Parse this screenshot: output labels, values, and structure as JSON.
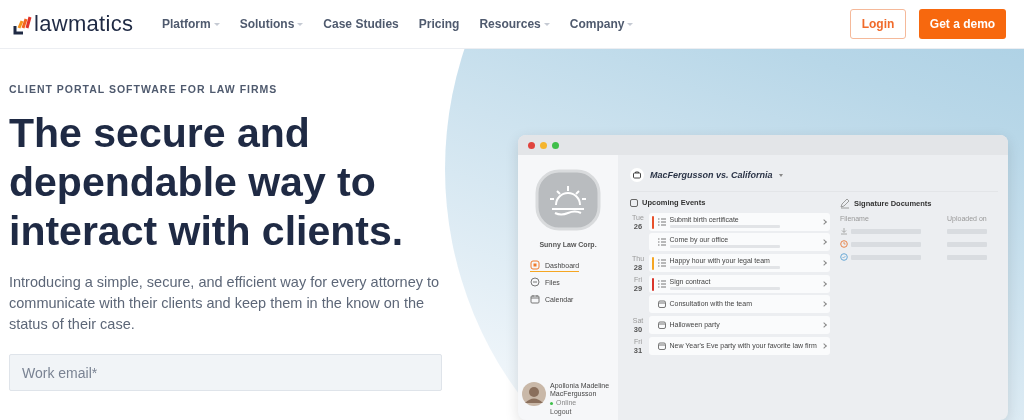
{
  "nav": {
    "logo": "lawmatics",
    "items": [
      {
        "label": "Platform",
        "dropdown": true
      },
      {
        "label": "Solutions",
        "dropdown": true
      },
      {
        "label": "Case Studies",
        "dropdown": false
      },
      {
        "label": "Pricing",
        "dropdown": false
      },
      {
        "label": "Resources",
        "dropdown": true
      },
      {
        "label": "Company",
        "dropdown": true
      }
    ],
    "login": "Login",
    "cta": "Get a demo"
  },
  "hero": {
    "eyebrow": "CLIENT PORTAL SOFTWARE FOR LAW FIRMS",
    "title": "The secure and dependable way to interact with clients.",
    "text": "Introducing a simple, secure, and efficient way for every attorney to communicate with their clients and keep them in the know on the status of their case.",
    "email": {
      "placeholder": "Work email*"
    }
  },
  "app": {
    "firm": "Sunny Law Corp.",
    "menu": [
      {
        "label": "Dashboard",
        "kind": "dashboard",
        "selected": true
      },
      {
        "label": "Files",
        "kind": "files",
        "selected": false
      },
      {
        "label": "Calendar",
        "kind": "calendar",
        "selected": false
      }
    ],
    "user": {
      "name": "Apollonia Madeline MacFergusson",
      "status": "Online",
      "logout": "Logout"
    },
    "case": "MacFergusson vs. California",
    "events_title": "Upcoming Events",
    "days": [
      {
        "weekday": "Tue",
        "day": "26",
        "events": [
          {
            "title": "Submit birth certificate",
            "kind": "task",
            "color": "#e8502a"
          },
          {
            "title": "Come by our office",
            "kind": "task"
          }
        ]
      },
      {
        "weekday": "Thu",
        "day": "28",
        "events": [
          {
            "title": "Happy hour with your legal team",
            "kind": "task",
            "color": "#f5a623"
          }
        ]
      },
      {
        "weekday": "Fri",
        "day": "29",
        "events": [
          {
            "title": "Sign contract",
            "kind": "task",
            "color": "#d9352b"
          },
          {
            "title": "Consultation with the team",
            "kind": "event"
          }
        ]
      },
      {
        "weekday": "Sat",
        "day": "30",
        "events": [
          {
            "title": "Halloween party",
            "kind": "event"
          }
        ]
      },
      {
        "weekday": "Fri",
        "day": "31",
        "events": [
          {
            "title": "New Year's Eve party with your favorite law firm",
            "kind": "event"
          }
        ]
      }
    ],
    "docs_title": "Signature Documents",
    "doc_columns": [
      "Filename",
      "Uploaded on"
    ],
    "docs": [
      {
        "kind": "download"
      },
      {
        "kind": "pending"
      },
      {
        "kind": "signed"
      }
    ]
  }
}
